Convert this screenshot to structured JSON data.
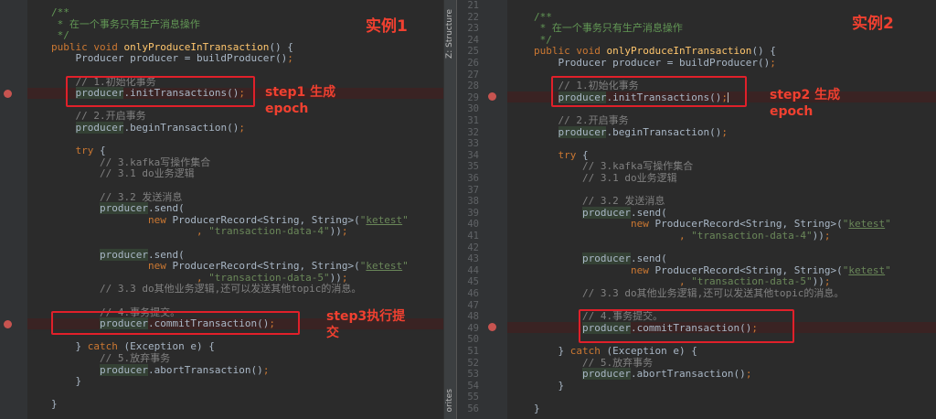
{
  "left": {
    "title": "实例1",
    "annotations": [
      "step1 生成\nepoch",
      "step3执行提\n交"
    ],
    "lines": [
      [
        {
          "t": "/**",
          "k": "c"
        }
      ],
      [
        {
          "t": " * 在一个事务只有生产消息操作",
          "k": "c"
        }
      ],
      [
        {
          "t": " */",
          "k": "c"
        }
      ],
      [
        {
          "t": "public void ",
          "k": "kw"
        },
        {
          "t": "onlyProduceInTransaction",
          "k": "fn"
        },
        {
          "t": "() {",
          "k": ""
        }
      ],
      [
        {
          "t": "    Producer producer = buildProducer()",
          "k": ""
        },
        {
          "t": ";",
          "k": "kw"
        }
      ],
      [],
      [
        {
          "t": "    // 1.初始化事务",
          "k": "c2"
        }
      ],
      [
        {
          "t": "    ",
          "k": ""
        },
        {
          "t": "producer",
          "k": "var"
        },
        {
          "t": ".initTransactions()",
          "k": ""
        },
        {
          "t": ";",
          "k": "kw"
        }
      ],
      [],
      [
        {
          "t": "    // 2.开启事务",
          "k": "c2"
        }
      ],
      [
        {
          "t": "    ",
          "k": ""
        },
        {
          "t": "producer",
          "k": "var"
        },
        {
          "t": ".beginTransaction()",
          "k": ""
        },
        {
          "t": ";",
          "k": "kw"
        }
      ],
      [],
      [
        {
          "t": "    ",
          "k": ""
        },
        {
          "t": "try",
          "k": "kw"
        },
        {
          "t": " {",
          "k": ""
        }
      ],
      [
        {
          "t": "        // 3.kafka写操作集合",
          "k": "c2"
        }
      ],
      [
        {
          "t": "        // 3.1 do业务逻辑",
          "k": "c2"
        }
      ],
      [],
      [
        {
          "t": "        // 3.2 发送消息",
          "k": "c2"
        }
      ],
      [
        {
          "t": "        ",
          "k": ""
        },
        {
          "t": "producer",
          "k": "var"
        },
        {
          "t": ".send(",
          "k": ""
        }
      ],
      [
        {
          "t": "                ",
          "k": ""
        },
        {
          "t": "new ",
          "k": "kw"
        },
        {
          "t": "ProducerRecord<String, String>(",
          "k": ""
        },
        {
          "t": "\"",
          "k": "str"
        },
        {
          "t": "ketest",
          "k": "strU"
        },
        {
          "t": "\"",
          "k": "str"
        }
      ],
      [
        {
          "t": "                        , ",
          "k": "kw"
        },
        {
          "t": "\"transaction-data-4\"",
          "k": "str"
        },
        {
          "t": "))",
          "k": ""
        },
        {
          "t": ";",
          "k": "kw"
        }
      ],
      [],
      [
        {
          "t": "        ",
          "k": ""
        },
        {
          "t": "producer",
          "k": "var"
        },
        {
          "t": ".send(",
          "k": ""
        }
      ],
      [
        {
          "t": "                ",
          "k": ""
        },
        {
          "t": "new ",
          "k": "kw"
        },
        {
          "t": "ProducerRecord<String, String>(",
          "k": ""
        },
        {
          "t": "\"",
          "k": "str"
        },
        {
          "t": "ketest",
          "k": "strU"
        },
        {
          "t": "\"",
          "k": "str"
        }
      ],
      [
        {
          "t": "                        , ",
          "k": "kw"
        },
        {
          "t": "\"transaction-data-5\"",
          "k": "str"
        },
        {
          "t": "))",
          "k": ""
        },
        {
          "t": ";",
          "k": "kw"
        }
      ],
      [
        {
          "t": "        // 3.3 do其他业务逻辑,还可以发送其他topic的消息。",
          "k": "c2"
        }
      ],
      [],
      [
        {
          "t": "        // 4.事务提交。",
          "k": "c2"
        }
      ],
      [
        {
          "t": "        ",
          "k": ""
        },
        {
          "t": "producer",
          "k": "var"
        },
        {
          "t": ".commitTransaction()",
          "k": ""
        },
        {
          "t": ";",
          "k": "kw"
        }
      ],
      [],
      [
        {
          "t": "    } ",
          "k": ""
        },
        {
          "t": "catch ",
          "k": "kw"
        },
        {
          "t": "(Exception e) {",
          "k": ""
        }
      ],
      [
        {
          "t": "        // 5.放弃事务",
          "k": "c2"
        }
      ],
      [
        {
          "t": "        ",
          "k": ""
        },
        {
          "t": "producer",
          "k": "var"
        },
        {
          "t": ".abortTransaction()",
          "k": ""
        },
        {
          "t": ";",
          "k": "kw"
        }
      ],
      [
        {
          "t": "    }",
          "k": ""
        }
      ],
      [],
      [
        {
          "t": "}",
          "k": ""
        }
      ]
    ]
  },
  "right": {
    "title": "实例2",
    "annotations": [
      "step2 生成\nepoch"
    ],
    "line_numbers": [
      21,
      22,
      23,
      24,
      25,
      26,
      27,
      28,
      29,
      30,
      31,
      32,
      33,
      34,
      35,
      36,
      37,
      38,
      39,
      40,
      41,
      42,
      43,
      44,
      45,
      46,
      47,
      48,
      49,
      50,
      51,
      52,
      53,
      54,
      55,
      56
    ],
    "lines": [
      [],
      [
        {
          "t": "/**",
          "k": "c"
        }
      ],
      [
        {
          "t": " * 在一个事务只有生产消息操作",
          "k": "c"
        }
      ],
      [
        {
          "t": " */",
          "k": "c"
        }
      ],
      [
        {
          "t": "public void ",
          "k": "kw"
        },
        {
          "t": "onlyProduceInTransaction",
          "k": "fn"
        },
        {
          "t": "() {",
          "k": ""
        }
      ],
      [
        {
          "t": "    Producer producer = buildProducer()",
          "k": ""
        },
        {
          "t": ";",
          "k": "kw"
        }
      ],
      [],
      [
        {
          "t": "    // 1.初始化事务",
          "k": "c2"
        }
      ],
      [
        {
          "t": "    ",
          "k": ""
        },
        {
          "t": "producer",
          "k": "var"
        },
        {
          "t": ".initTransactions()",
          "k": ""
        },
        {
          "t": ";",
          "k": "kw"
        },
        {
          "t": "",
          "k": "cursor"
        }
      ],
      [],
      [
        {
          "t": "    // 2.开启事务",
          "k": "c2"
        }
      ],
      [
        {
          "t": "    ",
          "k": ""
        },
        {
          "t": "producer",
          "k": "var"
        },
        {
          "t": ".beginTransaction()",
          "k": ""
        },
        {
          "t": ";",
          "k": "kw"
        }
      ],
      [],
      [
        {
          "t": "    ",
          "k": ""
        },
        {
          "t": "try",
          "k": "kw"
        },
        {
          "t": " {",
          "k": ""
        }
      ],
      [
        {
          "t": "        // 3.kafka写操作集合",
          "k": "c2"
        }
      ],
      [
        {
          "t": "        // 3.1 do业务逻辑",
          "k": "c2"
        }
      ],
      [],
      [
        {
          "t": "        // 3.2 发送消息",
          "k": "c2"
        }
      ],
      [
        {
          "t": "        ",
          "k": ""
        },
        {
          "t": "producer",
          "k": "var"
        },
        {
          "t": ".send(",
          "k": ""
        }
      ],
      [
        {
          "t": "                ",
          "k": ""
        },
        {
          "t": "new ",
          "k": "kw"
        },
        {
          "t": "ProducerRecord<String, String>(",
          "k": ""
        },
        {
          "t": "\"",
          "k": "str"
        },
        {
          "t": "ketest",
          "k": "strU"
        },
        {
          "t": "\"",
          "k": "str"
        }
      ],
      [
        {
          "t": "                        , ",
          "k": "kw"
        },
        {
          "t": "\"transaction-data-4\"",
          "k": "str"
        },
        {
          "t": "))",
          "k": ""
        },
        {
          "t": ";",
          "k": "kw"
        }
      ],
      [],
      [
        {
          "t": "        ",
          "k": ""
        },
        {
          "t": "producer",
          "k": "var"
        },
        {
          "t": ".send(",
          "k": ""
        }
      ],
      [
        {
          "t": "                ",
          "k": ""
        },
        {
          "t": "new ",
          "k": "kw"
        },
        {
          "t": "ProducerRecord<String, String>(",
          "k": ""
        },
        {
          "t": "\"",
          "k": "str"
        },
        {
          "t": "ketest",
          "k": "strU"
        },
        {
          "t": "\"",
          "k": "str"
        }
      ],
      [
        {
          "t": "                        , ",
          "k": "kw"
        },
        {
          "t": "\"transaction-data-5\"",
          "k": "str"
        },
        {
          "t": "))",
          "k": ""
        },
        {
          "t": ";",
          "k": "kw"
        }
      ],
      [
        {
          "t": "        // 3.3 do其他业务逻辑,还可以发送其他topic的消息。",
          "k": "c2"
        }
      ],
      [],
      [
        {
          "t": "        // 4.事务提交。",
          "k": "c2"
        }
      ],
      [
        {
          "t": "        ",
          "k": ""
        },
        {
          "t": "producer",
          "k": "var"
        },
        {
          "t": ".commitTransaction()",
          "k": ""
        },
        {
          "t": ";",
          "k": "kw"
        }
      ],
      [],
      [
        {
          "t": "    } ",
          "k": ""
        },
        {
          "t": "catch ",
          "k": "kw"
        },
        {
          "t": "(Exception e) {",
          "k": ""
        }
      ],
      [
        {
          "t": "        // 5.放弃事务",
          "k": "c2"
        }
      ],
      [
        {
          "t": "        ",
          "k": ""
        },
        {
          "t": "producer",
          "k": "var"
        },
        {
          "t": ".abortTransaction()",
          "k": ""
        },
        {
          "t": ";",
          "k": "kw"
        }
      ],
      [
        {
          "t": "    }",
          "k": ""
        }
      ],
      [],
      [
        {
          "t": "}",
          "k": ""
        }
      ]
    ]
  },
  "side_tabs": {
    "structure": "Z: Structure",
    "favorites": "orites"
  }
}
